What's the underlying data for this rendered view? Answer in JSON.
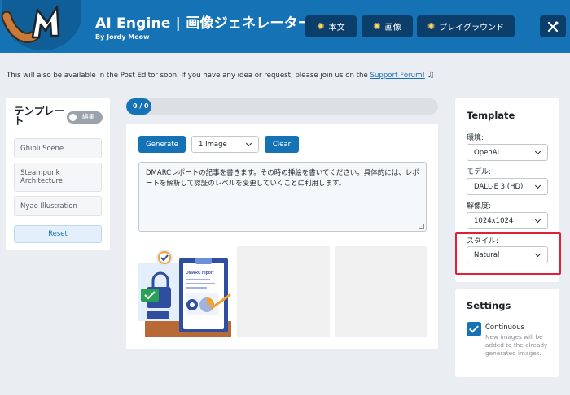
{
  "header": {
    "title": "AI Engine | 画像ジェネレーター",
    "byline": "By Jordy Meow",
    "buttons": [
      {
        "label": "本文",
        "icon": "sparkle-icon"
      },
      {
        "label": "画像",
        "icon": "sparkle-icon"
      },
      {
        "label": "プレイグラウンド",
        "icon": "sparkle-icon"
      },
      {
        "label": "",
        "icon": "tools-icon"
      }
    ]
  },
  "notice": {
    "text": "This will also be available in the Post Editor soon. If you have any idea or request, please join us on the",
    "link": "Support Forum!",
    "icon": "music-note-icon"
  },
  "templates": {
    "title": "テンプレート",
    "toggle_label": "編集",
    "items": [
      "Ghibli Scene",
      "Steampunk Architecture",
      "Nyao Illustration"
    ],
    "reset_label": "Reset"
  },
  "progress": {
    "text": "0 / 0",
    "value": 0.08
  },
  "generator": {
    "generate_label": "Generate",
    "count_value": "1 Image",
    "clear_label": "Clear",
    "prompt": "DMARCレポートの記事を書きます。その時の挿絵を書いてください。具体的には、レポートを解析して認証のレベルを変更していくことに利用します。",
    "image_title": "DMARC report"
  },
  "template_panel": {
    "title": "Template",
    "env_label": "環境:",
    "env_value": "OpenAI",
    "model_label": "モデル:",
    "model_value": "DALL-E 3 (HD)",
    "resolution_label": "解像度:",
    "resolution_value": "1024x1024",
    "style_label": "スタイル:",
    "style_value": "Natural"
  },
  "settings": {
    "title": "Settings",
    "continuous_label": "Continuous",
    "continuous_checked": true,
    "continuous_desc": "New images will be added to the already generated images."
  },
  "colors": {
    "primary": "#1472b5",
    "header_button": "#0c3e6c",
    "highlight": "#e0203b"
  }
}
